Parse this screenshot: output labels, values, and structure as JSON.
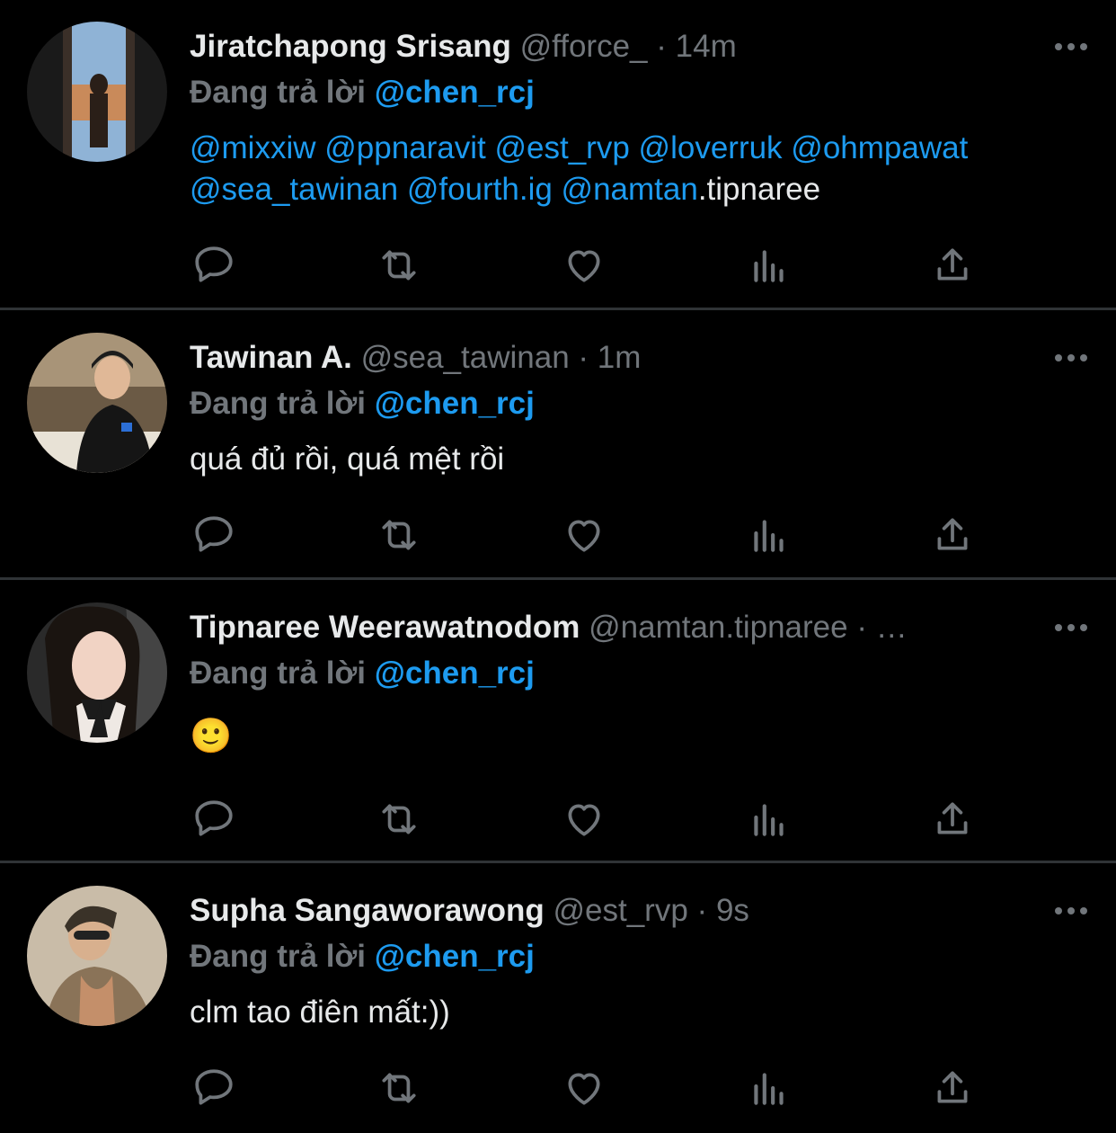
{
  "tweets": [
    {
      "name": "Jiratchapong Srisang",
      "handle": "@fforce_",
      "time": "14m",
      "reply_prefix": "Đang trả lời",
      "reply_to": "@chen_rcj",
      "body_mentions_line1": [
        "@mixxiw",
        "@ppnaravit",
        "@est_rvp",
        "@loverruk",
        "@ohmpawat"
      ],
      "body_mentions_line2": [
        "@sea_tawinan",
        "@fourth.ig",
        "@namtan"
      ],
      "body_tail": ".tipnaree"
    },
    {
      "name": "Tawinan A.",
      "handle": "@sea_tawinan",
      "time": "1m",
      "reply_prefix": "Đang trả lời",
      "reply_to": "@chen_rcj",
      "text": "quá đủ rồi, quá mệt rồi"
    },
    {
      "name": "Tipnaree Weerawatnodom",
      "handle": "@namtan.tipnaree",
      "time": "…",
      "reply_prefix": "Đang trả lời",
      "reply_to": "@chen_rcj",
      "text": "🙂"
    },
    {
      "name": "Supha Sangaworawong",
      "handle": "@est_rvp",
      "time": "9s",
      "reply_prefix": "Đang trả lời",
      "reply_to": "@chen_rcj",
      "text": "clm tao điên mất:))"
    }
  ],
  "separator": "·",
  "icons": [
    "reply-icon",
    "retweet-icon",
    "like-icon",
    "analytics-icon",
    "share-icon",
    "more-icon"
  ],
  "colors": {
    "background": "#000000",
    "text": "#e7e9ea",
    "muted": "#71767b",
    "link": "#1d9bf0",
    "divider": "#2f3336"
  }
}
